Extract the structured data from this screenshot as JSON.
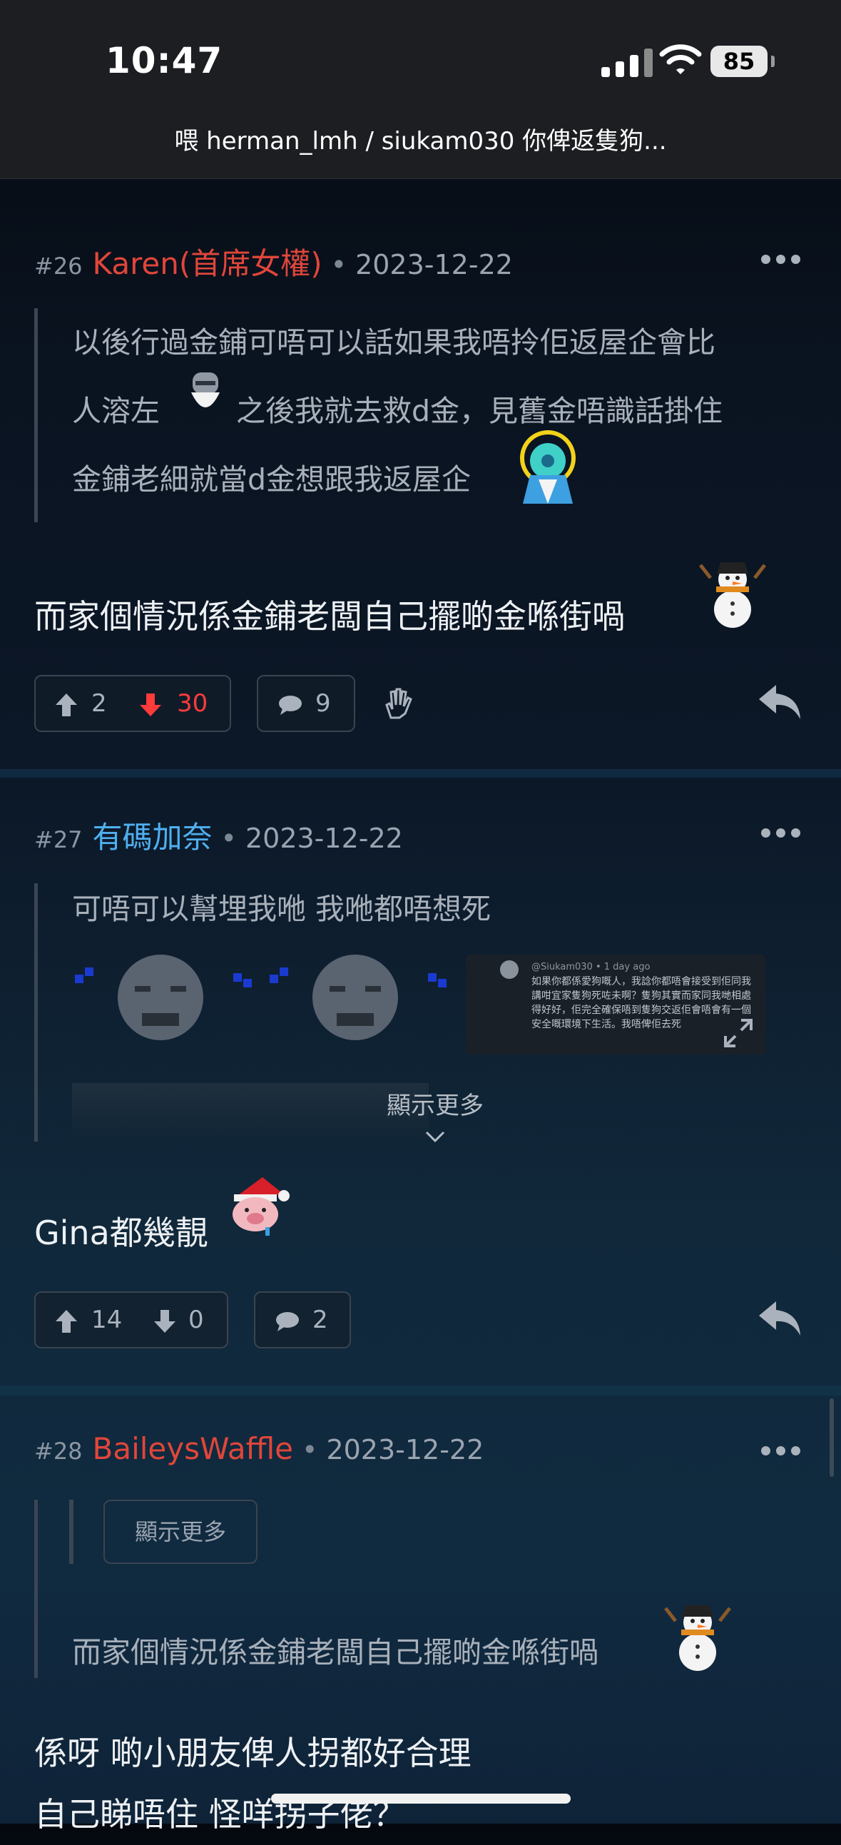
{
  "status_bar": {
    "time": "10:47",
    "battery": "85"
  },
  "title": "喂 herman_lmh / siukam030 你俾返隻狗...",
  "colors": {
    "red_name": "#e0463a",
    "blue_name": "#4fb0f0",
    "downvote_active": "#ff3b3b"
  },
  "posts": [
    {
      "number": "#26",
      "username": "Karen(首席女權)",
      "date": "2023-12-22",
      "quote_lines": [
        "以後行過金鋪可唔可以話如果我唔拎佢返屋企會比",
        "人溶左",
        "之後我就去救d金，見舊金唔識話掛住",
        "金鋪老細就當d金想跟我返屋企"
      ],
      "body": "而家個情況係金鋪老闆自己擺啲金喺街喎",
      "upvotes": "2",
      "downvotes": "30",
      "comments": "9",
      "icons": [
        "arrow-up-icon",
        "arrow-down-icon",
        "comment-icon",
        "hand-icon",
        "reply-icon",
        "snowman-emoji",
        "bearded-face-emoji",
        "ghost-emoji"
      ]
    },
    {
      "number": "#27",
      "username": "有碼加奈",
      "date": "2023-12-22",
      "quote_lines": [
        "可唔可以幫埋我咃 我咃都唔想死"
      ],
      "embedded_image": {
        "user": "@Siukam030 • 1 day ago",
        "text": "如果你都係愛狗嘅人，我諗你都唔會接受到佢同我講咁宜家隻狗死咗未啊？隻狗其實而家同我哋相處得好好，佢完全確保唔到隻狗交返佢會唔會有一個安全嘅環境下生活。我唔俾佢去死"
      },
      "show_more": "顯示更多",
      "body": "Gina都幾靚",
      "upvotes": "14",
      "downvotes": "0",
      "comments": "2",
      "icons": [
        "crying-face-emoji",
        "pig-santa-emoji",
        "expand-icon",
        "chevron-down-icon"
      ]
    },
    {
      "number": "#28",
      "username": "BaileysWaffle",
      "date": "2023-12-22",
      "show_more": "顯示更多",
      "quote_lines": [
        "而家個情況係金鋪老闆自己擺啲金喺街喎"
      ],
      "body_lines": [
        "係呀 啲小朋友俾人拐都好合理",
        "自己睇唔住 怪咩拐子佬？"
      ]
    }
  ]
}
